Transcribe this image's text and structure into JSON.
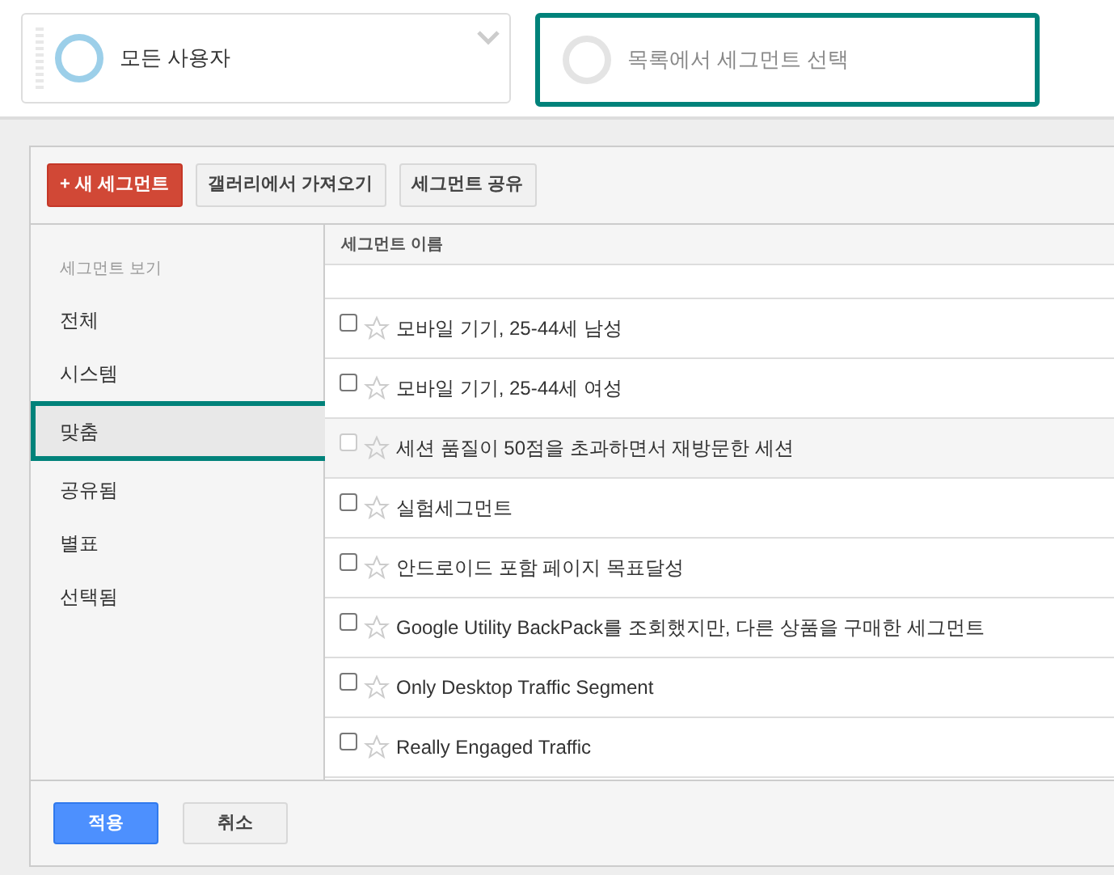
{
  "segment_slots": [
    {
      "label": "모든 사용자",
      "filled": true,
      "selected": false
    },
    {
      "label": "목록에서 세그먼트 선택",
      "filled": false,
      "selected": true
    }
  ],
  "toolbar": {
    "new_button": "+ 새 세그먼트",
    "buttons": [
      "갤러리에서 가져오기",
      "세그먼트 공유"
    ]
  },
  "sidebar": {
    "heading": "세그먼트 보기",
    "items": [
      {
        "label": "전체",
        "selected": false
      },
      {
        "label": "시스템",
        "selected": false
      },
      {
        "label": "맞춤",
        "selected": true
      },
      {
        "label": "공유됨",
        "selected": false
      },
      {
        "label": "별표",
        "selected": false
      },
      {
        "label": "선택됨",
        "selected": false
      }
    ]
  },
  "table": {
    "column": "세그먼트 이름",
    "rows": [
      {
        "name": "모바일 기기, 25-44세 남성",
        "checked": false,
        "disabled": false,
        "starred": false
      },
      {
        "name": "모바일 기기, 25-44세 여성",
        "checked": false,
        "disabled": false,
        "starred": false
      },
      {
        "name": "세션 품질이 50점을 초과하면서 재방문한 세션",
        "checked": false,
        "disabled": true,
        "starred": false
      },
      {
        "name": "실험세그먼트",
        "checked": false,
        "disabled": false,
        "starred": false
      },
      {
        "name": "안드로이드 포함 페이지 목표달성",
        "checked": false,
        "disabled": false,
        "starred": false
      },
      {
        "name": "Google Utility BackPack를 조회했지만, 다른 상품을 구매한 세그먼트",
        "checked": false,
        "disabled": false,
        "starred": false
      },
      {
        "name": "Only Desktop Traffic Segment",
        "checked": false,
        "disabled": false,
        "starred": false
      },
      {
        "name": "Really Engaged Traffic",
        "checked": false,
        "disabled": false,
        "starred": false
      }
    ]
  },
  "footer": {
    "apply": "적용",
    "cancel": "취소"
  }
}
